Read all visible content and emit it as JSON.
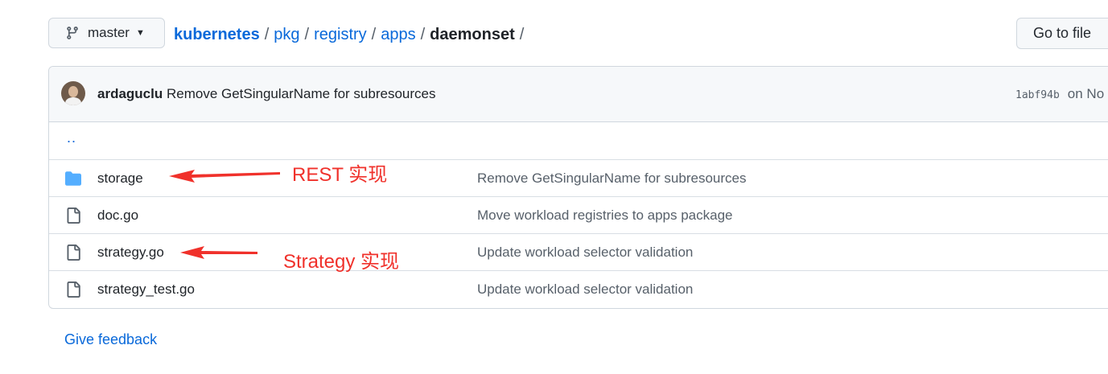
{
  "branch": {
    "label": "master",
    "icon": "git-branch-icon"
  },
  "breadcrumb": {
    "items": [
      "kubernetes",
      "pkg",
      "registry",
      "apps"
    ],
    "current": "daemonset",
    "separator": "/"
  },
  "goto_button": {
    "label": "Go to file"
  },
  "commit": {
    "author": "ardaguclu",
    "message": "Remove GetSingularName for subresources",
    "sha": "1abf94b",
    "date_prefix": "on No"
  },
  "files": {
    "parent": "..",
    "rows": [
      {
        "name": "storage",
        "type": "folder",
        "icon": "folder-icon",
        "message": "Remove GetSingularName for subresources"
      },
      {
        "name": "doc.go",
        "type": "file",
        "icon": "file-icon",
        "message": "Move workload registries to apps package"
      },
      {
        "name": "strategy.go",
        "type": "file",
        "icon": "file-icon",
        "message": "Update workload selector validation"
      },
      {
        "name": "strategy_test.go",
        "type": "file",
        "icon": "file-icon",
        "message": "Update workload selector validation"
      }
    ]
  },
  "feedback": {
    "label": "Give feedback"
  },
  "annotations": {
    "rest": "REST 实现",
    "strategy": "Strategy 实现",
    "color": "#f0312b"
  },
  "colors": {
    "link": "#0969da",
    "folder": "#54aeff",
    "muted": "#57606a"
  }
}
